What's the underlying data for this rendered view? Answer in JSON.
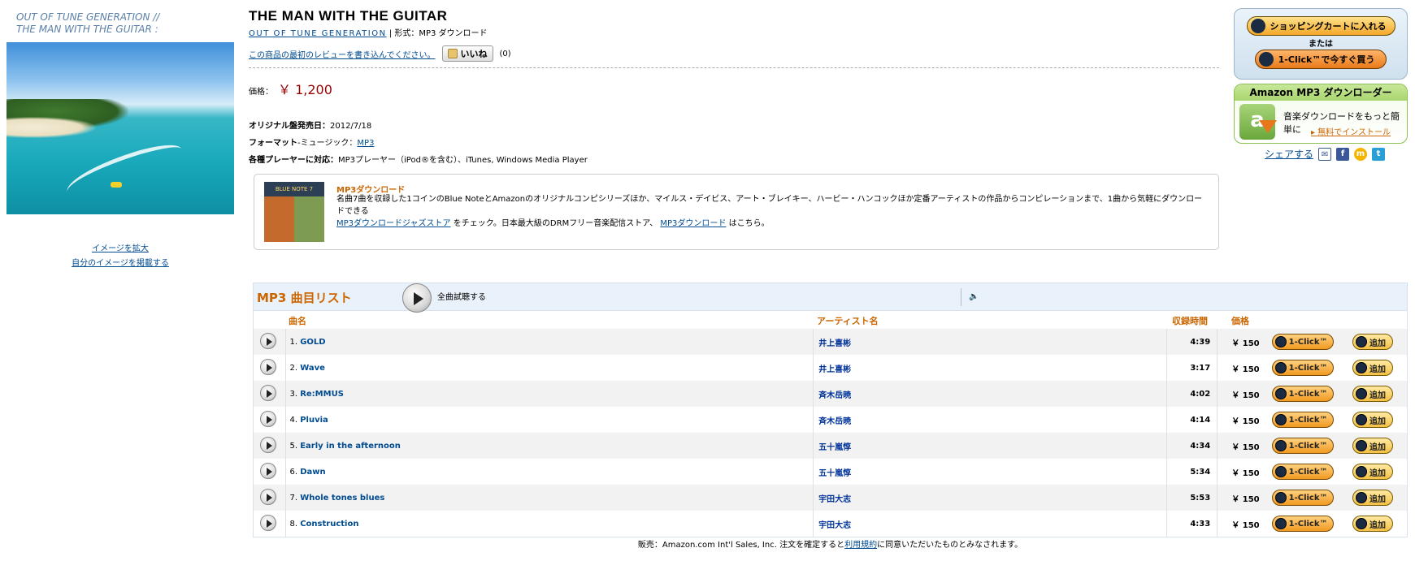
{
  "album_caption": {
    "line1": "OUT OF TUNE GENERATION //",
    "line2": "THE MAN WITH THE GUITAR :"
  },
  "image_links": {
    "enlarge": "イメージを拡大",
    "upload": "自分のイメージを掲載する"
  },
  "product": {
    "title": "THE MAN WITH THE GUITAR",
    "artist": "OUT OF TUNE GENERATION",
    "format_sep": "| 形式：",
    "format": "MP3 ダウンロード",
    "review_link": "この商品の最初のレビューを書き込んでください。",
    "like_label": "いいね",
    "like_count": "(0)",
    "price_label": "価格：",
    "price": "￥ 1,200",
    "release_label": "オリジナル盤発売日：",
    "release_date": "2012/7/18",
    "format_label": "フォーマット",
    "format_music": "-ミュージック：",
    "format_link": "MP3",
    "players_label": "各種プレーヤーに対応：",
    "players": "MP3プレーヤー（iPod®を含む）、iTunes, Windows Media Player"
  },
  "promo": {
    "image_text": "BLUE NOTE 7 VOCALS",
    "title": "MP3ダウンロード",
    "body1": "名曲7曲を収録した1コインのBlue NoteとAmazonのオリジナルコンピシリーズほか、マイルス・デイビス、アート・ブレイキー、ハービー・ハンコックほか定番アーティストの作品からコンピレーションまで、1曲から気軽にダウンロードできる",
    "link1": "MP3ダウンロードジャズストア",
    "body2": "をチェック。日本最大級のDRMフリー音楽配信ストア、",
    "link2": "MP3ダウンロード",
    "body3": "はこちら。"
  },
  "tracklist": {
    "title": "MP3 曲目リスト",
    "play_all": "全曲試聴する",
    "col_title": "曲名",
    "col_artist": "アーティスト名",
    "col_time": "収録時間",
    "col_price": "価格",
    "oneclick_label": "1-Click™",
    "add_label": "追加",
    "tracks": [
      {
        "no": "1.",
        "title": "GOLD",
        "artist": "井上喜彬",
        "time": "4:39",
        "price": "￥ 150"
      },
      {
        "no": "2.",
        "title": "Wave",
        "artist": "井上喜彬",
        "time": "3:17",
        "price": "￥ 150"
      },
      {
        "no": "3.",
        "title": "Re:MMUS",
        "artist": "斉木岳暁",
        "time": "4:02",
        "price": "￥ 150"
      },
      {
        "no": "4.",
        "title": "Pluvia",
        "artist": "斉木岳暁",
        "time": "4:14",
        "price": "￥ 150"
      },
      {
        "no": "5.",
        "title": "Early in the afternoon",
        "artist": "五十嵐惇",
        "time": "4:34",
        "price": "￥ 150"
      },
      {
        "no": "6.",
        "title": "Dawn",
        "artist": "五十嵐惇",
        "time": "5:34",
        "price": "￥ 150"
      },
      {
        "no": "7.",
        "title": "Whole tones blues",
        "artist": "宇田大志",
        "time": "5:53",
        "price": "￥ 150"
      },
      {
        "no": "8.",
        "title": "Construction",
        "artist": "宇田大志",
        "time": "4:33",
        "price": "￥ 150"
      }
    ]
  },
  "footer": {
    "text1": "販売：Amazon.com Int'l Sales, Inc.  注文を確定すると",
    "link": "利用規約",
    "text2": "に同意いただいたものとみなされます。"
  },
  "buybox": {
    "cart_button": "ショッピングカートに入れる",
    "or_text": "または",
    "oneclick_button": "1-Click™で今すぐ買う"
  },
  "downloader": {
    "title": "Amazon MP3 ダウンローダー",
    "icon_letter": "a",
    "text": "音楽ダウンロードをもっと簡単に",
    "install_link": "無料でインストール"
  },
  "share": {
    "label": "シェアする"
  },
  "colors": {
    "accent_orange": "#cc6600",
    "link_blue": "#004b91",
    "price_red": "#990000"
  }
}
